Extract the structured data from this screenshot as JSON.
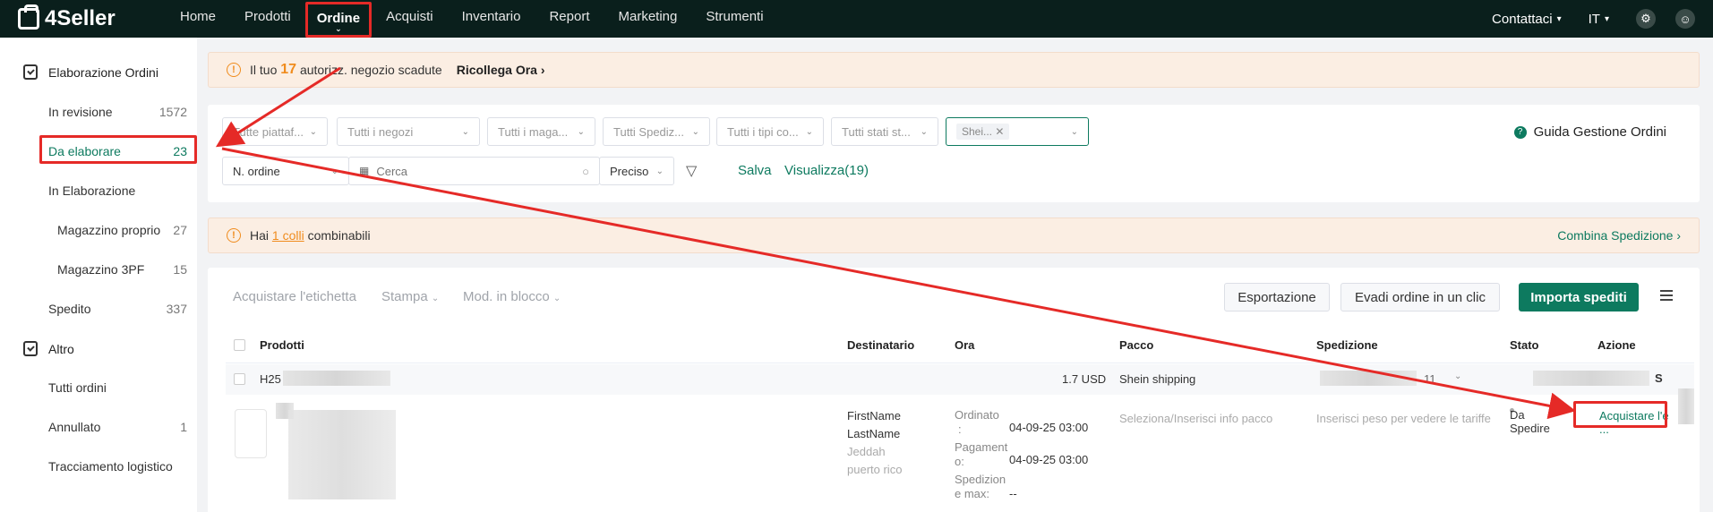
{
  "app": {
    "logo_text": "4Seller"
  },
  "nav": {
    "items": [
      "Home",
      "Prodotti",
      "Ordine",
      "Acquisti",
      "Inventario",
      "Report",
      "Marketing",
      "Strumenti"
    ],
    "active_index": 2,
    "contact": "Contattaci",
    "language": "IT"
  },
  "sidebar": {
    "group1": "Elaborazione Ordini",
    "items": [
      {
        "label": "In revisione",
        "count": "1572"
      },
      {
        "label": "Da elaborare",
        "count": "23"
      },
      {
        "label": "In Elaborazione",
        "count": ""
      },
      {
        "label": "Magazzino proprio",
        "count": "27"
      },
      {
        "label": "Magazzino 3PF",
        "count": "15"
      },
      {
        "label": "Spedito",
        "count": "337"
      }
    ],
    "group2": "Altro",
    "items2": [
      {
        "label": "Tutti ordini",
        "count": ""
      },
      {
        "label": "Annullato",
        "count": "1"
      },
      {
        "label": "Tracciamento logistico",
        "count": ""
      }
    ]
  },
  "alert1": {
    "prefix": "Il tuo",
    "count": "17",
    "suffix": "autorizz. negozio scadute",
    "action": "Ricollega Ora"
  },
  "filters": {
    "platform": "Tutte piattaf...",
    "stores": "Tutti i negozi",
    "warehouses": "Tutti i maga...",
    "shipping": "Tutti Spediz...",
    "types": "Tutti i tipi co...",
    "status": "Tutti stati st...",
    "active_tag": "Shei...",
    "guide": "Guida Gestione Ordini",
    "search_field": "N. ordine",
    "search_placeholder": "Cerca",
    "match": "Preciso",
    "save": "Salva",
    "view": "Visualizza(19)"
  },
  "alert2": {
    "prefix": "Hai",
    "link": "1 colli",
    "suffix": "combinabili",
    "action": "Combina Spedizione"
  },
  "toolbar": {
    "buy_label": "Acquistare l'etichetta",
    "print": "Stampa",
    "bulk": "Mod. in blocco",
    "export": "Esportazione",
    "fulfill": "Evadi ordine in un clic",
    "import": "Importa spediti"
  },
  "table": {
    "headers": [
      "Prodotti",
      "Destinatario",
      "Ora",
      "Pacco",
      "Spedizione",
      "Stato",
      "Azione"
    ],
    "order_row": {
      "order_prefix": "H25",
      "amount": "1.7 USD",
      "carrier": "Shein shipping",
      "shipping_tail": "11",
      "action_tail": "S"
    },
    "detail_row": {
      "first_name": "FirstName",
      "last_name": "LastName",
      "city": "Jeddah",
      "region": "puerto rico",
      "ordered_label": "Ordinato",
      "ordered_sep": ":",
      "ordered_value": "04-09-25 03:00",
      "payment_label": "Pagament",
      "payment_sep": "o:",
      "payment_value": "04-09-25 03:00",
      "ship_max_label": "Spedizion",
      "ship_max_sep": "e max:",
      "ship_max_value": "--",
      "package_hint": "Seleziona/Inserisci info pacco",
      "shipping_hint": "Inserisci peso per vedere le tariffe",
      "status": "Da Spedire",
      "action": "Acquistare l'e",
      "more": "..."
    }
  },
  "colors": {
    "brand": "#0d7a5f",
    "topbar": "#0a1f1c",
    "highlight": "#e52a27",
    "warning": "#f08c1e"
  }
}
